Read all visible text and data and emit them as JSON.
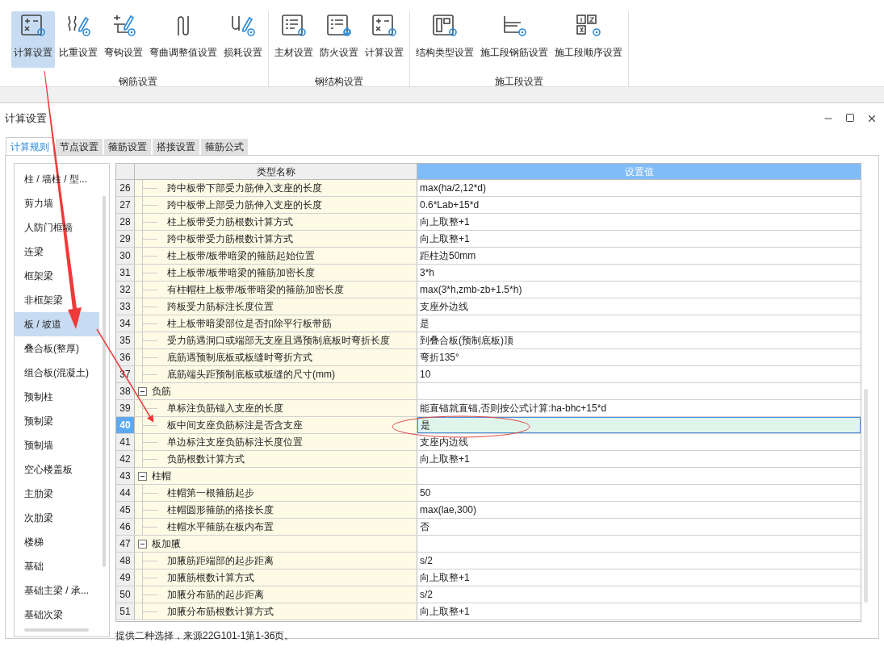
{
  "ribbon": {
    "groups": [
      {
        "label": "钢筋设置",
        "buttons": [
          {
            "label": "计算设置",
            "selected": true
          },
          {
            "label": "比重设置",
            "selected": false
          },
          {
            "label": "弯钩设置",
            "selected": false
          },
          {
            "label": "弯曲调整值设置",
            "selected": false
          },
          {
            "label": "损耗设置",
            "selected": false
          }
        ]
      },
      {
        "label": "钢结构设置",
        "buttons": [
          {
            "label": "主材设置",
            "selected": false
          },
          {
            "label": "防火设置",
            "selected": false
          },
          {
            "label": "计算设置",
            "selected": false
          }
        ]
      },
      {
        "label": "施工段设置",
        "buttons": [
          {
            "label": "结构类型设置",
            "selected": false
          },
          {
            "label": "施工段钢筋设置",
            "selected": false
          },
          {
            "label": "施工段顺序设置",
            "selected": false
          }
        ]
      }
    ]
  },
  "dialog": {
    "title": "计算设置",
    "tabs": [
      {
        "label": "计算规则",
        "selected": true
      },
      {
        "label": "节点设置",
        "selected": false
      },
      {
        "label": "箍筋设置",
        "selected": false
      },
      {
        "label": "搭接设置",
        "selected": false
      },
      {
        "label": "箍筋公式",
        "selected": false
      }
    ],
    "sidebar": {
      "items": [
        {
          "label": "柱 / 墙柱 / 型...",
          "selected": false
        },
        {
          "label": "剪力墙",
          "selected": false
        },
        {
          "label": "人防门框墙",
          "selected": false
        },
        {
          "label": "连梁",
          "selected": false
        },
        {
          "label": "框架梁",
          "selected": false
        },
        {
          "label": "非框架梁",
          "selected": false
        },
        {
          "label": "板 / 坡道",
          "selected": true
        },
        {
          "label": "叠合板(整厚)",
          "selected": false
        },
        {
          "label": "组合板(混凝土)",
          "selected": false
        },
        {
          "label": "预制柱",
          "selected": false
        },
        {
          "label": "预制梁",
          "selected": false
        },
        {
          "label": "预制墙",
          "selected": false
        },
        {
          "label": "空心楼盖板",
          "selected": false
        },
        {
          "label": "主肋梁",
          "selected": false
        },
        {
          "label": "次肋梁",
          "selected": false
        },
        {
          "label": "楼梯",
          "selected": false
        },
        {
          "label": "基础",
          "selected": false
        },
        {
          "label": "基础主梁 / 承...",
          "selected": false
        },
        {
          "label": "基础次梁",
          "selected": false
        }
      ]
    },
    "table": {
      "columns": [
        "类型名称",
        "设置值"
      ],
      "rows": [
        {
          "number": "26",
          "kind": "item",
          "name": "跨中板带下部受力筋伸入支座的长度",
          "value": "max(ha/2,12*d)",
          "selected": false
        },
        {
          "number": "27",
          "kind": "item",
          "name": "跨中板带上部受力筋伸入支座的长度",
          "value": "0.6*Lab+15*d",
          "selected": false
        },
        {
          "number": "28",
          "kind": "item",
          "name": "柱上板带受力筋根数计算方式",
          "value": "向上取整+1",
          "selected": false
        },
        {
          "number": "29",
          "kind": "item",
          "name": "跨中板带受力筋根数计算方式",
          "value": "向上取整+1",
          "selected": false
        },
        {
          "number": "30",
          "kind": "item",
          "name": "柱上板带/板带暗梁的箍筋起始位置",
          "value": "距柱边50mm",
          "selected": false
        },
        {
          "number": "31",
          "kind": "item",
          "name": "柱上板带/板带暗梁的箍筋加密长度",
          "value": "3*h",
          "selected": false
        },
        {
          "number": "32",
          "kind": "item",
          "name": "有柱帽柱上板带/板带暗梁的箍筋加密长度",
          "value": "max(3*h,zmb-zb+1.5*h)",
          "selected": false
        },
        {
          "number": "33",
          "kind": "item",
          "name": "跨板受力筋标注长度位置",
          "value": "支座外边线",
          "selected": false
        },
        {
          "number": "34",
          "kind": "item",
          "name": "柱上板带暗梁部位是否扣除平行板带筋",
          "value": "是",
          "selected": false
        },
        {
          "number": "35",
          "kind": "item",
          "name": "受力筋遇洞口或端部无支座且遇预制底板时弯折长度",
          "value": "到叠合板(预制底板)顶",
          "selected": false
        },
        {
          "number": "36",
          "kind": "item",
          "name": "底筋遇预制底板或板缝时弯折方式",
          "value": "弯折135°",
          "selected": false
        },
        {
          "number": "37",
          "kind": "item",
          "name": "底筋端头距预制底板或板缝的尺寸(mm)",
          "value": "10",
          "selected": false
        },
        {
          "number": "38",
          "kind": "group",
          "name": "负筋",
          "expanded": true,
          "selected": false
        },
        {
          "number": "39",
          "kind": "item",
          "name": "单标注负筋锚入支座的长度",
          "value": "能直锚就直锚,否则按公式计算:ha-bhc+15*d",
          "selected": false
        },
        {
          "number": "40",
          "kind": "item",
          "name": "板中间支座负筋标注是否含支座",
          "value": "是",
          "selected": true
        },
        {
          "number": "41",
          "kind": "item",
          "name": "单边标注支座负筋标注长度位置",
          "value": "支座内边线",
          "selected": false
        },
        {
          "number": "42",
          "kind": "item",
          "name": "负筋根数计算方式",
          "value": "向上取整+1",
          "selected": false
        },
        {
          "number": "43",
          "kind": "group",
          "name": "柱帽",
          "expanded": true,
          "selected": false
        },
        {
          "number": "44",
          "kind": "item",
          "name": "柱帽第一根箍筋起步",
          "value": "50",
          "selected": false
        },
        {
          "number": "45",
          "kind": "item",
          "name": "柱帽圆形箍筋的搭接长度",
          "value": "max(lae,300)",
          "selected": false
        },
        {
          "number": "46",
          "kind": "item",
          "name": "柱帽水平箍筋在板内布置",
          "value": "否",
          "selected": false
        },
        {
          "number": "47",
          "kind": "group",
          "name": "板加腋",
          "expanded": true,
          "selected": false
        },
        {
          "number": "48",
          "kind": "item",
          "name": "加腋筋距端部的起步距离",
          "value": "s/2",
          "selected": false
        },
        {
          "number": "49",
          "kind": "item",
          "name": "加腋筋根数计算方式",
          "value": "向上取整+1",
          "selected": false
        },
        {
          "number": "50",
          "kind": "item",
          "name": "加腋分布筋的起步距离",
          "value": "s/2",
          "selected": false
        },
        {
          "number": "51",
          "kind": "item",
          "name": "加腋分布筋根数计算方式",
          "value": "向上取整+1",
          "selected": false
        }
      ]
    },
    "description": "提供二种选择，来源22G101-1第1-36页。"
  }
}
